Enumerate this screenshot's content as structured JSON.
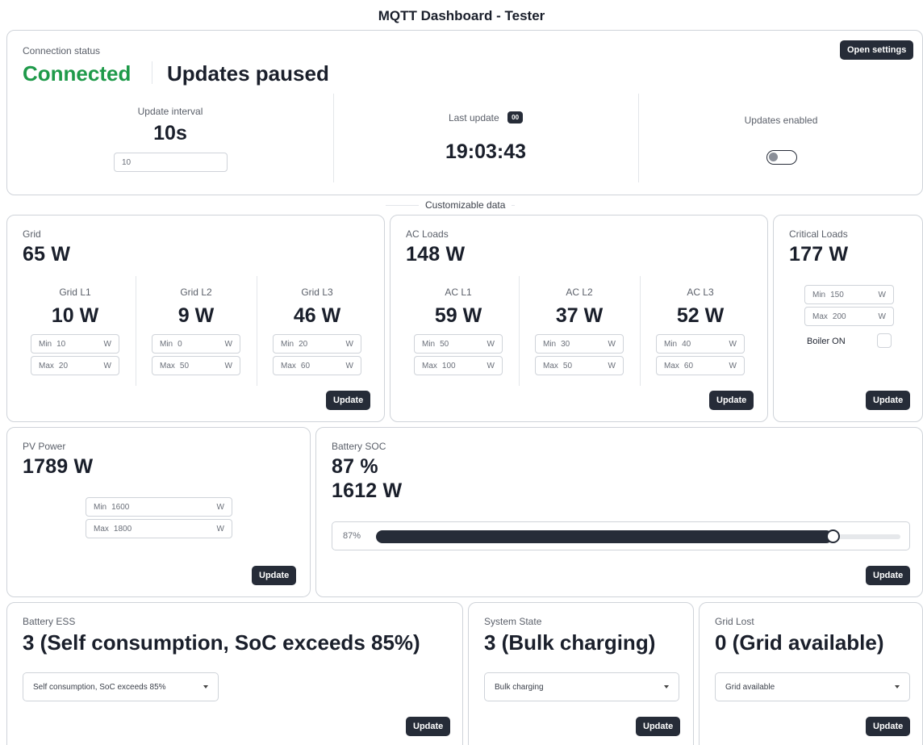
{
  "app": {
    "title": "MQTT Dashboard - Tester"
  },
  "connection": {
    "label": "Connection status",
    "status": "Connected",
    "updates_state": "Updates paused",
    "settings_button": "Open settings",
    "interval_label": "Update interval",
    "interval_value": "10s",
    "interval_input": "10",
    "last_update_label": "Last update",
    "last_update_badge": "00",
    "last_update_time": "19:03:43",
    "updates_enabled_label": "Updates enabled",
    "updates_enabled": false
  },
  "divider_label": "Customizable data",
  "grid": {
    "label": "Grid",
    "value": "65 W",
    "phases": [
      {
        "label": "Grid L1",
        "value": "10 W",
        "min": "10",
        "max": "20"
      },
      {
        "label": "Grid L2",
        "value": "9 W",
        "min": "0",
        "max": "50"
      },
      {
        "label": "Grid L3",
        "value": "46 W",
        "min": "20",
        "max": "60"
      }
    ]
  },
  "ac_loads": {
    "label": "AC Loads",
    "value": "148 W",
    "phases": [
      {
        "label": "AC L1",
        "value": "59 W",
        "min": "50",
        "max": "100"
      },
      {
        "label": "AC L2",
        "value": "37 W",
        "min": "30",
        "max": "50"
      },
      {
        "label": "AC L3",
        "value": "52 W",
        "min": "40",
        "max": "60"
      }
    ]
  },
  "critical_loads": {
    "label": "Critical Loads",
    "value": "177 W",
    "min": "150",
    "max": "200",
    "boiler_label": "Boiler ON",
    "boiler_on": false
  },
  "pv": {
    "label": "PV Power",
    "value": "1789 W",
    "min": "1600",
    "max": "1800"
  },
  "battery_soc": {
    "label": "Battery SOC",
    "soc": "87 %",
    "power": "1612 W",
    "slider_label": "87%",
    "slider_fraction": 0.87
  },
  "battery_ess": {
    "label": "Battery ESS",
    "value": "3 (Self consumption, SoC exceeds 85%)",
    "selected": "Self consumption, SoC exceeds 85%"
  },
  "system_state": {
    "label": "System State",
    "value": "3 (Bulk charging)",
    "selected": "Bulk charging"
  },
  "grid_lost": {
    "label": "Grid Lost",
    "value": "0 (Grid available)",
    "selected": "Grid available"
  },
  "common": {
    "min_prefix": "Min",
    "max_prefix": "Max",
    "unit": "W",
    "update_button": "Update"
  },
  "colors": {
    "connected": "#1f9a4a",
    "dark": "#262c38",
    "border": "#cfd3d9"
  }
}
